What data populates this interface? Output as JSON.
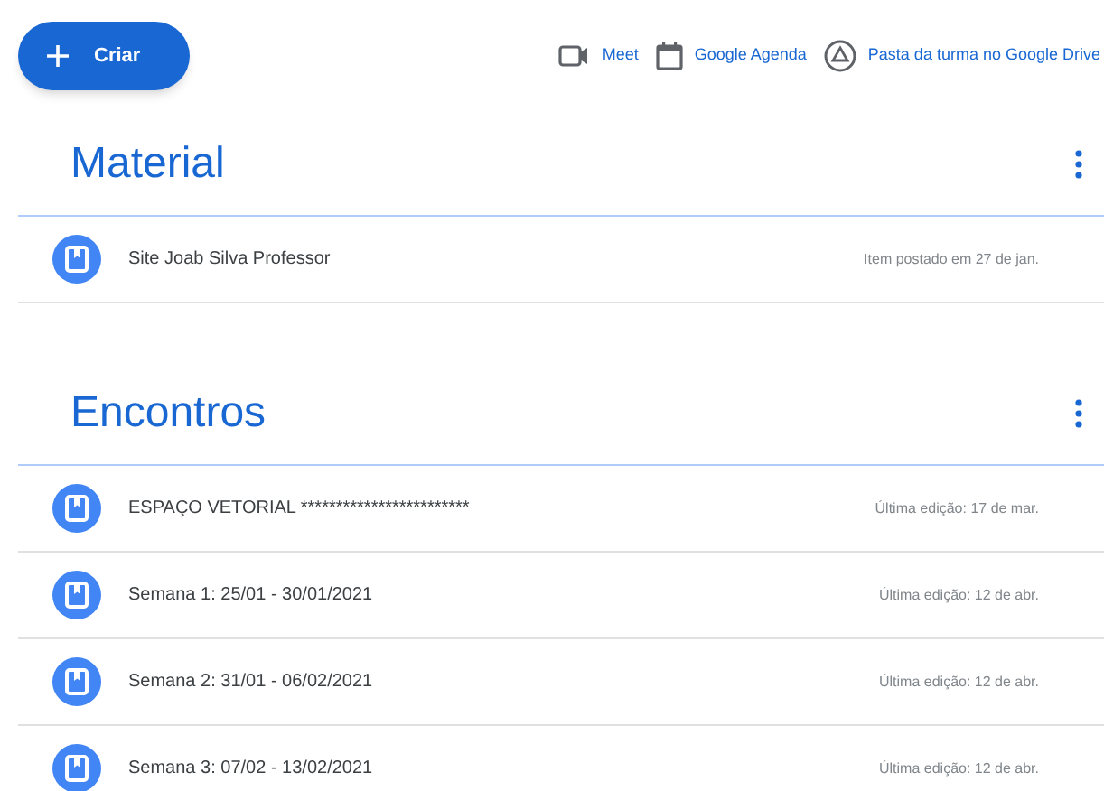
{
  "create_button": {
    "label": "Criar"
  },
  "links": [
    {
      "kind": "video",
      "label": "Meet"
    },
    {
      "kind": "calendar",
      "label": "Google Agenda"
    },
    {
      "kind": "drive",
      "label": "Pasta da turma no Google Drive"
    }
  ],
  "topics": [
    {
      "title": "Material",
      "items": [
        {
          "title": "Site Joab Silva Professor",
          "meta": "Item postado em 27 de jan."
        }
      ]
    },
    {
      "title": "Encontros",
      "items": [
        {
          "title": "ESPAÇO VETORIAL ************************",
          "meta": "Última edição: 17 de mar."
        },
        {
          "title": "Semana 1: 25/01 - 30/01/2021",
          "meta": "Última edição: 12 de abr."
        },
        {
          "title": "Semana 2: 31/01 - 06/02/2021",
          "meta": "Última edição: 12 de abr."
        },
        {
          "title": "Semana 3: 07/02 - 13/02/2021",
          "meta": "Última edição: 12 de abr."
        }
      ]
    }
  ]
}
